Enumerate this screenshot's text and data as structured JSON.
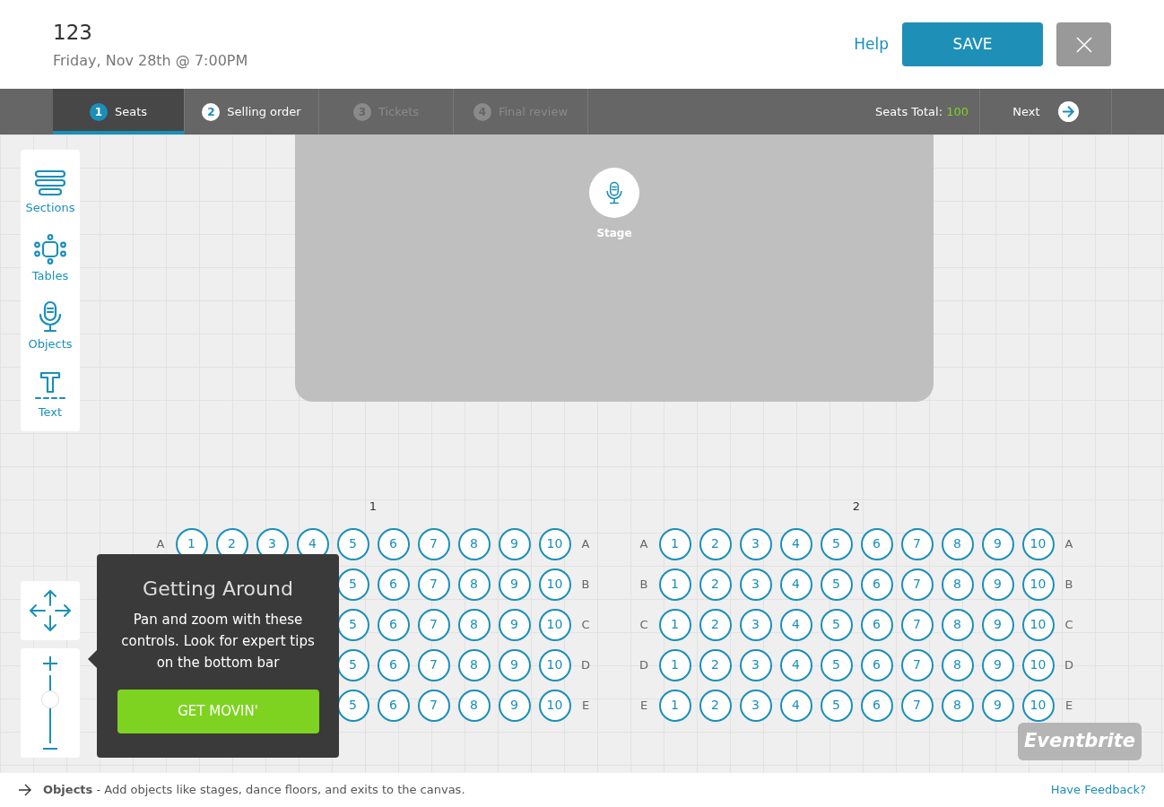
{
  "header": {
    "title": "123",
    "subtitle": "Friday, Nov 28th @ 7:00PM",
    "help": "Help",
    "save": "SAVE"
  },
  "steps": [
    {
      "number": "1",
      "label": "Seats",
      "selected": true,
      "disabled": false
    },
    {
      "number": "2",
      "label": "Selling order",
      "selected": false,
      "disabled": false
    },
    {
      "number": "3",
      "label": "Tickets",
      "selected": false,
      "disabled": true
    },
    {
      "number": "4",
      "label": "Final review",
      "selected": false,
      "disabled": true
    }
  ],
  "seats_total": {
    "label": "Seats Total:",
    "value": "100"
  },
  "next": "Next",
  "tools": [
    {
      "kind": "sections",
      "label": "Sections"
    },
    {
      "kind": "tables",
      "label": "Tables"
    },
    {
      "kind": "objects",
      "label": "Objects"
    },
    {
      "kind": "text",
      "label": "Text"
    }
  ],
  "stage": {
    "label": "Stage"
  },
  "sections": [
    {
      "title": "1",
      "rows": [
        {
          "label_left": "A",
          "seats": [
            "1",
            "2",
            "3",
            "4",
            "5",
            "6",
            "7",
            "8",
            "9",
            "10"
          ],
          "label_right": "A"
        },
        {
          "seats": [
            "5",
            "6",
            "7",
            "8",
            "9",
            "10"
          ],
          "label_right": "B"
        },
        {
          "seats": [
            "5",
            "6",
            "7",
            "8",
            "9",
            "10"
          ],
          "label_right": "C"
        },
        {
          "seats": [
            "5",
            "6",
            "7",
            "8",
            "9",
            "10"
          ],
          "label_right": "D"
        },
        {
          "seats": [
            "5",
            "6",
            "7",
            "8",
            "9",
            "10"
          ],
          "label_right": "E"
        }
      ]
    },
    {
      "title": "2",
      "rows": [
        {
          "label_left": "A",
          "seats": [
            "1",
            "2",
            "3",
            "4",
            "5",
            "6",
            "7",
            "8",
            "9",
            "10"
          ],
          "label_right": "A"
        },
        {
          "label_left": "B",
          "seats": [
            "1",
            "2",
            "3",
            "4",
            "5",
            "6",
            "7",
            "8",
            "9",
            "10"
          ],
          "label_right": "B"
        },
        {
          "label_left": "C",
          "seats": [
            "1",
            "2",
            "3",
            "4",
            "5",
            "6",
            "7",
            "8",
            "9",
            "10"
          ],
          "label_right": "C"
        },
        {
          "label_left": "D",
          "seats": [
            "1",
            "2",
            "3",
            "4",
            "5",
            "6",
            "7",
            "8",
            "9",
            "10"
          ],
          "label_right": "D"
        },
        {
          "label_left": "E",
          "seats": [
            "1",
            "2",
            "3",
            "4",
            "5",
            "6",
            "7",
            "8",
            "9",
            "10"
          ],
          "label_right": "E"
        }
      ]
    }
  ],
  "zoom": {
    "level": 0.65
  },
  "tip": {
    "title": "Getting Around",
    "text": "Pan and zoom with these controls. Look for expert tips on the bottom bar",
    "button": "GET MOVIN'"
  },
  "brand_badge": "Eventbrite",
  "status_bar": {
    "text": "**Objects** - Add objects like stages, dance floors, and exits to the canvas.",
    "feedback": "Have Feedback?"
  }
}
